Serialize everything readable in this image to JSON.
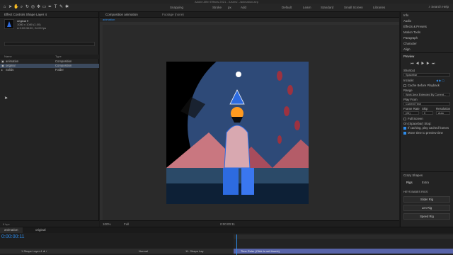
{
  "window_title": "Adobe After Effects 2021 - /Users/.../animation.aep",
  "toolbar": {
    "snapping_label": "Snapping",
    "stroke_label": "Stroke",
    "stroke_value": "px",
    "add_label": "Add",
    "workspaces": [
      "Default",
      "Learn",
      "Standard",
      "Small Screen",
      "Libraries"
    ],
    "search_help": "Search Help"
  },
  "project": {
    "effect_controls_tab": "Effect Controls Shape Layer 4",
    "item_name": "original ▾",
    "item_meta_1": "1080 x 1080 (1.00)",
    "item_meta_2": "Δ 0:00:08:00, 24.00 fps",
    "col_name": "Name",
    "col_type": "Type",
    "rows": [
      {
        "name": "animation",
        "type": "Composition"
      },
      {
        "name": "original",
        "type": "Composition"
      },
      {
        "name": "Solids",
        "type": "Folder"
      }
    ],
    "footer": "8 bpc"
  },
  "comp": {
    "tab_label": "Composition animation",
    "footage_tab": "Footage (none)",
    "subtab": "animation",
    "zoom": "100%",
    "quality": "Full",
    "timecode": "0:00:00:11"
  },
  "right_panel": {
    "items": [
      "Info",
      "Audio",
      "Effects & Presets",
      "Motion Tools",
      "Paragraph",
      "Character",
      "Align",
      "Preview"
    ],
    "shortcut_label": "Shortcut",
    "shortcut_value": "Spacebar",
    "include_label": "Include:",
    "cache_label": "Cache Before Playback",
    "range_label": "Range",
    "range_value": "Work Area Extended By Current...",
    "play_from_label": "Play From",
    "play_from_value": "Current Time",
    "frame_rate_label": "Frame Rate",
    "skip_label": "Skip",
    "resolution_label": "Resolution",
    "frame_rate_value": "(24)",
    "skip_value": "0",
    "resolution_value": "Auto",
    "full_screen_label": "Full Screen",
    "on_stop_label": "On (Spacebar) Stop:",
    "if_caching_label": "If caching, play cached frames",
    "move_time_label": "Move time to preview time",
    "crazy_shapes_label": "Crazy Shapes",
    "rigs_tab": "Rigs",
    "extra_tab": "Extra",
    "rig_header": "HEYS BABES RIGS",
    "slider_rig": "Slider Rig",
    "len_rig": "Len Rig",
    "speed_rig": "Speed Rig"
  },
  "timeline": {
    "tabs": [
      "animation",
      "original"
    ],
    "current_time": "0:00:00:11",
    "layer_row": "1  Shape Layer 4  ★ /",
    "blend_mode": "Normal",
    "parent": "11. Shape Lay",
    "track_bar_label": "Time Ruler (Click to set thumb)"
  },
  "colors": {
    "accent": "#2d8ceb",
    "track_bar": "#5863a8",
    "selected_row": "#3c4a5e"
  }
}
